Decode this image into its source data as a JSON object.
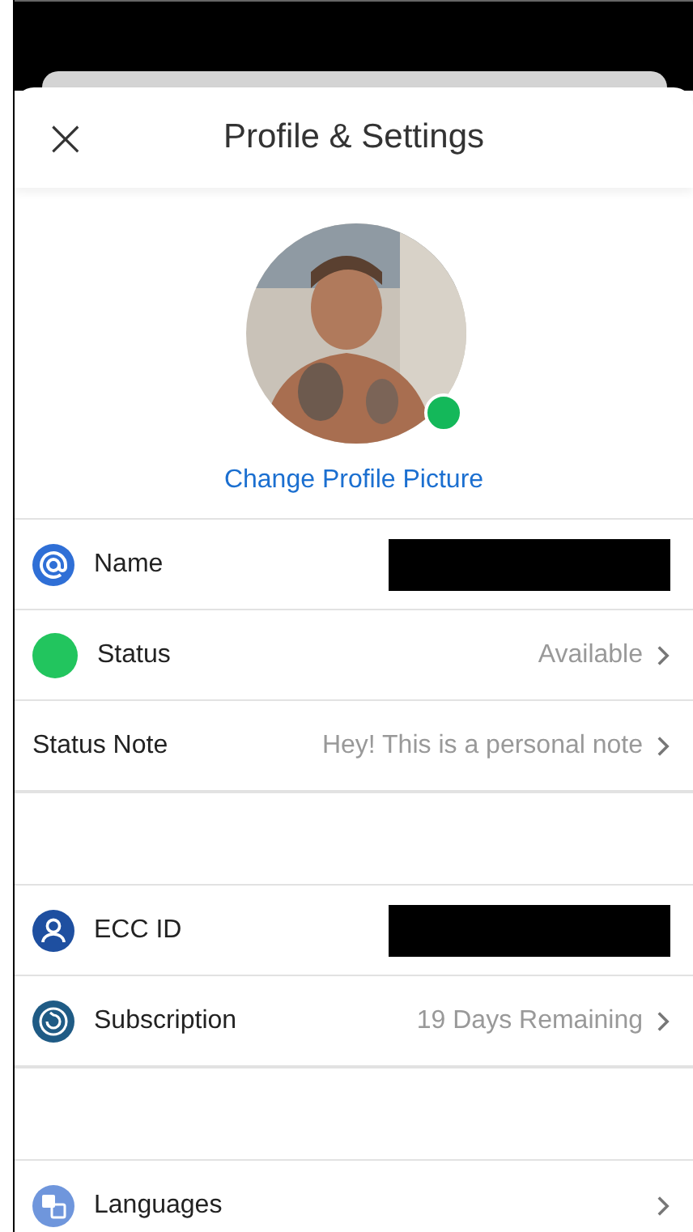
{
  "header": {
    "close": "×",
    "title": "Profile & Settings"
  },
  "profile": {
    "kind": "picture",
    "online": true,
    "change_link": "Change Profile Picture"
  },
  "sections": [
    {
      "rows": [
        {
          "kind": "at",
          "label": "Name",
          "redacted": true,
          "chevron": false
        },
        {
          "kind": "dot",
          "color": "#22c55e",
          "label": "Status",
          "value": "Available",
          "chevron": true
        },
        {
          "kind": "plain",
          "label": "Status Note",
          "value": "Hey! This is a personal note",
          "chevron": true
        }
      ]
    },
    {
      "rows": [
        {
          "kind": "person",
          "label": "ECC ID",
          "redacted": true,
          "chevron": false
        },
        {
          "kind": "refresh",
          "label": "Subscription",
          "value": "19 Days Remaining",
          "chevron": true
        }
      ]
    },
    {
      "rows": [
        {
          "kind": "translate",
          "label": "Languages",
          "chevron": true
        }
      ]
    }
  ]
}
